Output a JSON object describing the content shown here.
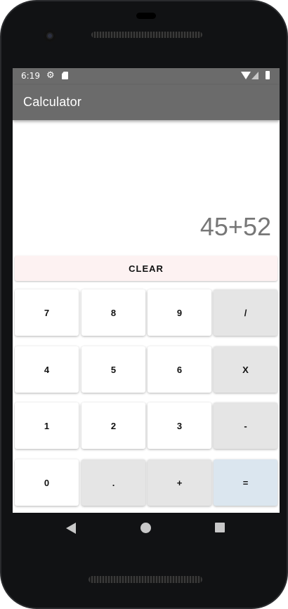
{
  "status_bar": {
    "time": "6:19",
    "icons": [
      "gear-icon",
      "sd-card-icon",
      "wifi-icon",
      "signal-icon",
      "battery-icon"
    ]
  },
  "app_bar": {
    "title": "Calculator"
  },
  "display": {
    "expression": "45+52"
  },
  "clear_button": {
    "label": "CLEAR"
  },
  "keypad": {
    "rows": [
      [
        "7",
        "8",
        "9",
        "/"
      ],
      [
        "4",
        "5",
        "6",
        "X"
      ],
      [
        "1",
        "2",
        "3",
        "-"
      ],
      [
        "0",
        ".",
        "+",
        "="
      ]
    ]
  },
  "nav_bar": {
    "icons": [
      "back-icon",
      "home-icon",
      "recents-icon"
    ]
  },
  "colors": {
    "app_bar": "#6b6b6b",
    "clear_button": "#fdf2f2",
    "number_key": "#ffffff",
    "operator_key": "#e5e5e5",
    "equals_key": "#dbe6ef",
    "display_text": "#777777"
  }
}
